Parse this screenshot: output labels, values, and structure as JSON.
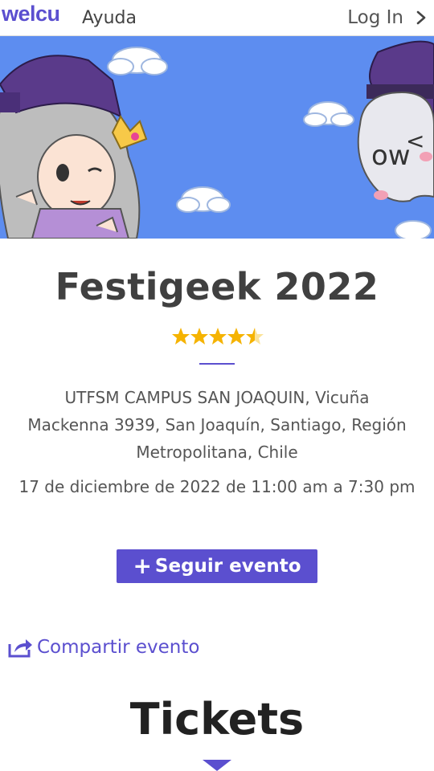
{
  "header": {
    "logo": "welcu",
    "help": "Ayuda",
    "login": "Log In",
    "login_icon": "chevron-right-icon"
  },
  "banner": {
    "background": "#5d8df0",
    "description_icon": "festigeek-banner-illustration"
  },
  "event": {
    "title": "Festigeek 2022",
    "rating": {
      "value": 4.5,
      "max": 5,
      "color": "#f5b301"
    },
    "address": "UTFSM CAMPUS SAN JOAQUIN, Vicuña Mackenna 3939, San Joaquín, Santiago, Región Metropolitana, Chile",
    "date": "17 de diciembre de 2022 de 11:00 am a 7:30 pm",
    "follow_label": "Seguir evento",
    "follow_icon": "plus-icon",
    "share_label": "Compartir evento",
    "share_icon": "share-icon"
  },
  "tickets": {
    "heading": "Tickets",
    "icon": "triangle-down-icon"
  },
  "colors": {
    "accent": "#5b4fcf",
    "star": "#f5b301"
  }
}
